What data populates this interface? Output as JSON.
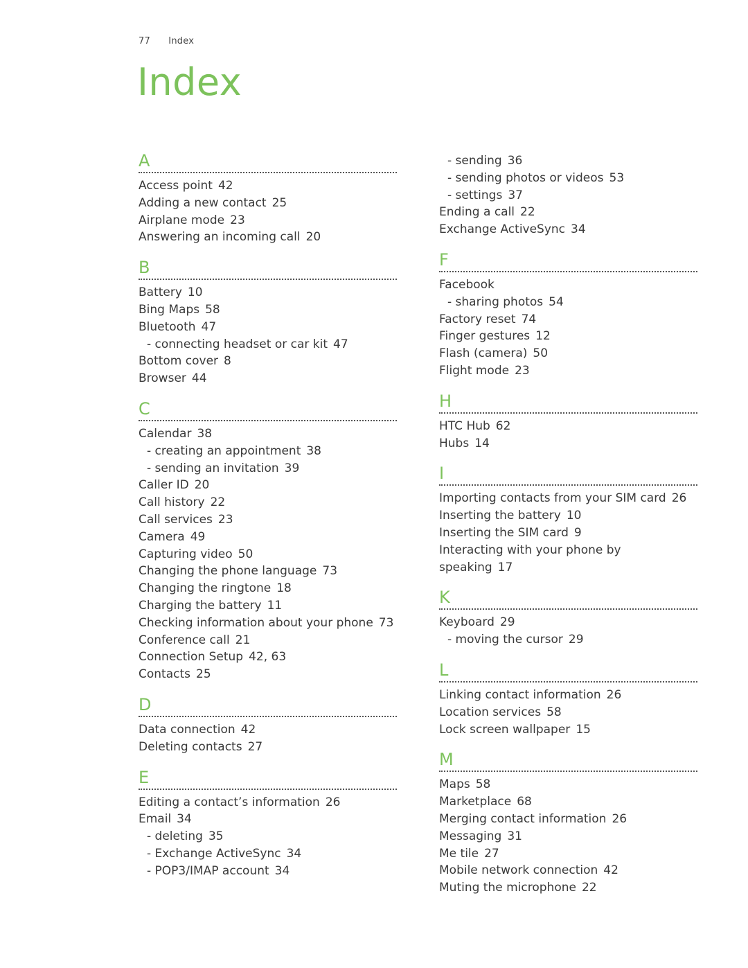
{
  "header": {
    "page_number": "77",
    "section": "Index"
  },
  "title": "Index",
  "colors": {
    "accent": "#7dc25c",
    "text": "#3a3a3a",
    "rule": "#555555"
  },
  "left_column": [
    {
      "letter": "A",
      "entries": [
        {
          "term": "Access point",
          "pages": "42",
          "sub": false
        },
        {
          "term": "Adding a new contact",
          "pages": "25",
          "sub": false
        },
        {
          "term": "Airplane mode",
          "pages": "23",
          "sub": false
        },
        {
          "term": "Answering an incoming call",
          "pages": "20",
          "sub": false
        }
      ]
    },
    {
      "letter": "B",
      "entries": [
        {
          "term": "Battery",
          "pages": "10",
          "sub": false
        },
        {
          "term": "Bing Maps",
          "pages": "58",
          "sub": false
        },
        {
          "term": "Bluetooth",
          "pages": "47",
          "sub": false
        },
        {
          "term": "- connecting headset or car kit",
          "pages": "47",
          "sub": true
        },
        {
          "term": "Bottom cover",
          "pages": "8",
          "sub": false
        },
        {
          "term": "Browser",
          "pages": "44",
          "sub": false
        }
      ]
    },
    {
      "letter": "C",
      "entries": [
        {
          "term": "Calendar",
          "pages": "38",
          "sub": false
        },
        {
          "term": "- creating an appointment",
          "pages": "38",
          "sub": true
        },
        {
          "term": "- sending an invitation",
          "pages": "39",
          "sub": true
        },
        {
          "term": "Caller ID",
          "pages": "20",
          "sub": false
        },
        {
          "term": "Call history",
          "pages": "22",
          "sub": false
        },
        {
          "term": "Call services",
          "pages": "23",
          "sub": false
        },
        {
          "term": "Camera",
          "pages": "49",
          "sub": false
        },
        {
          "term": "Capturing video",
          "pages": "50",
          "sub": false
        },
        {
          "term": "Changing the phone language",
          "pages": "73",
          "sub": false
        },
        {
          "term": "Changing the ringtone",
          "pages": "18",
          "sub": false
        },
        {
          "term": "Charging the battery",
          "pages": "11",
          "sub": false
        },
        {
          "term": "Checking information about your phone",
          "pages": "73",
          "sub": false
        },
        {
          "term": "Conference call",
          "pages": "21",
          "sub": false
        },
        {
          "term": "Connection Setup",
          "pages": "42, 63",
          "sub": false
        },
        {
          "term": "Contacts",
          "pages": "25",
          "sub": false
        }
      ]
    },
    {
      "letter": "D",
      "entries": [
        {
          "term": "Data connection",
          "pages": "42",
          "sub": false
        },
        {
          "term": "Deleting contacts",
          "pages": "27",
          "sub": false
        }
      ]
    },
    {
      "letter": "E",
      "entries": [
        {
          "term": "Editing a contact’s information",
          "pages": "26",
          "sub": false
        },
        {
          "term": "Email",
          "pages": "34",
          "sub": false
        },
        {
          "term": "- deleting",
          "pages": "35",
          "sub": true
        },
        {
          "term": "- Exchange ActiveSync",
          "pages": "34",
          "sub": true
        },
        {
          "term": "- POP3/IMAP account",
          "pages": "34",
          "sub": true
        }
      ]
    }
  ],
  "right_column": [
    {
      "letter": "",
      "continued": true,
      "entries": [
        {
          "term": "- sending",
          "pages": "36",
          "sub": true
        },
        {
          "term": "- sending photos or videos",
          "pages": "53",
          "sub": true
        },
        {
          "term": "- settings",
          "pages": "37",
          "sub": true
        },
        {
          "term": "Ending a call",
          "pages": "22",
          "sub": false
        },
        {
          "term": "Exchange ActiveSync",
          "pages": "34",
          "sub": false
        }
      ]
    },
    {
      "letter": "F",
      "entries": [
        {
          "term": "Facebook",
          "pages": "",
          "sub": false
        },
        {
          "term": "- sharing photos",
          "pages": "54",
          "sub": true
        },
        {
          "term": "Factory reset",
          "pages": "74",
          "sub": false
        },
        {
          "term": "Finger gestures",
          "pages": "12",
          "sub": false
        },
        {
          "term": "Flash (camera)",
          "pages": "50",
          "sub": false
        },
        {
          "term": "Flight mode",
          "pages": "23",
          "sub": false
        }
      ]
    },
    {
      "letter": "H",
      "entries": [
        {
          "term": "HTC Hub",
          "pages": "62",
          "sub": false
        },
        {
          "term": "Hubs",
          "pages": "14",
          "sub": false
        }
      ]
    },
    {
      "letter": "I",
      "entries": [
        {
          "term": "Importing contacts from your SIM card",
          "pages": "26",
          "sub": false
        },
        {
          "term": "Inserting the battery",
          "pages": "10",
          "sub": false
        },
        {
          "term": "Inserting the SIM card",
          "pages": "9",
          "sub": false
        },
        {
          "term": "Interacting with your phone by speaking",
          "pages": "17",
          "sub": false
        }
      ]
    },
    {
      "letter": "K",
      "entries": [
        {
          "term": "Keyboard",
          "pages": "29",
          "sub": false
        },
        {
          "term": "- moving the cursor",
          "pages": "29",
          "sub": true
        }
      ]
    },
    {
      "letter": "L",
      "entries": [
        {
          "term": "Linking contact information",
          "pages": "26",
          "sub": false
        },
        {
          "term": "Location services",
          "pages": "58",
          "sub": false
        },
        {
          "term": "Lock screen wallpaper",
          "pages": "15",
          "sub": false
        }
      ]
    },
    {
      "letter": "M",
      "entries": [
        {
          "term": "Maps",
          "pages": "58",
          "sub": false
        },
        {
          "term": "Marketplace",
          "pages": "68",
          "sub": false
        },
        {
          "term": "Merging contact information",
          "pages": "26",
          "sub": false
        },
        {
          "term": "Messaging",
          "pages": "31",
          "sub": false
        },
        {
          "term": "Me tile",
          "pages": "27",
          "sub": false
        },
        {
          "term": "Mobile network connection",
          "pages": "42",
          "sub": false
        },
        {
          "term": "Muting the microphone",
          "pages": "22",
          "sub": false
        }
      ]
    }
  ]
}
